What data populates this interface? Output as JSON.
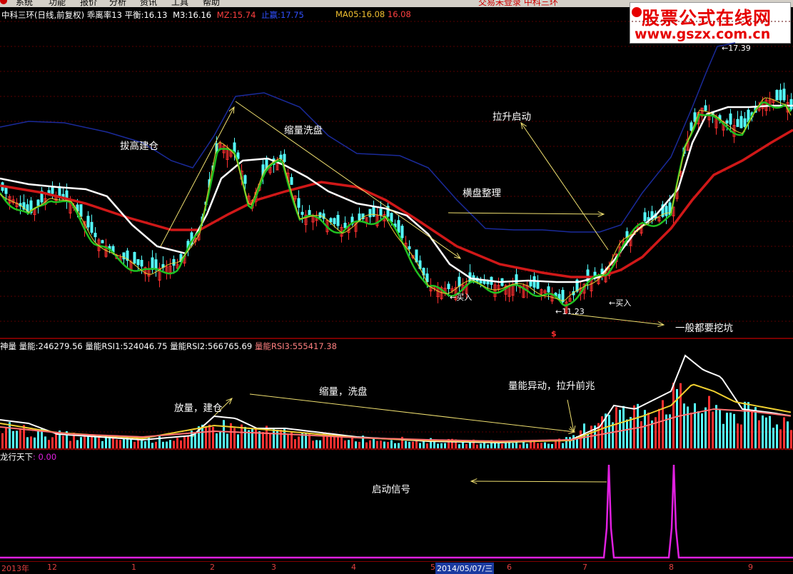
{
  "menu": {
    "items": [
      "系统",
      "功能",
      "报价",
      "分析",
      "资讯",
      "工具",
      "帮助"
    ],
    "title": "交易未登录 中科三环"
  },
  "main_info": {
    "stock": "中科三环(日线,前复权)",
    "indicator": "乖离率13",
    "balance_label": "平衡:",
    "balance_value": "16.13",
    "m3_label": "M3:",
    "m3_value": "16.16",
    "mz_label": "MZ:",
    "mz_value": "15.74",
    "stop_label": "止赢:",
    "stop_value": "17.75",
    "ma05_label": "MA05:",
    "ma05_value": "16.08",
    "ma05_value2": "16.08"
  },
  "watermark": {
    "title": "股票公式在线网",
    "url": "www.gszx.com.cn"
  },
  "annotations": {
    "build": "拔高建仓",
    "wash": "缩量洗盘",
    "launch": "拉升启动",
    "consolidate": "横盘整理",
    "buy1": "←买入",
    "buy2": "←买入",
    "pit": "一般都要挖坑",
    "high_price": "←17.39",
    "low_price": "←11.23",
    "dollar": "$"
  },
  "volume_info": {
    "name": "神量",
    "v_label": "量能:",
    "v_value": "246279.56",
    "r1_label": "量能RSI1:",
    "r1_value": "524046.75",
    "r2_label": "量能RSI2:",
    "r2_value": "566765.69",
    "r3_label": "量能RSI3:",
    "r3_value": "555417.38"
  },
  "volume_annotations": {
    "a1": "放量，建仓",
    "a2": "缩量，洗盘",
    "a3": "量能异动，拉升前兆"
  },
  "signal_info": {
    "name": "龙行天下",
    "value": ": 0.00",
    "annotation": "启动信号"
  },
  "time_axis": {
    "labels": [
      "2013年",
      "12",
      "1",
      "2",
      "3",
      "4",
      "5",
      "6",
      "7",
      "8",
      "9"
    ],
    "selected": "2014/05/07/三"
  },
  "colors": {
    "up": "#ff3030",
    "down": "#54ffff",
    "ma_white": "#ffffff",
    "ma_red": "#d01818",
    "ma_green": "#20c020",
    "ma_yellow": "#f0d030",
    "band_blue": "#1a2a9a",
    "signal": "#e020e0"
  }
}
